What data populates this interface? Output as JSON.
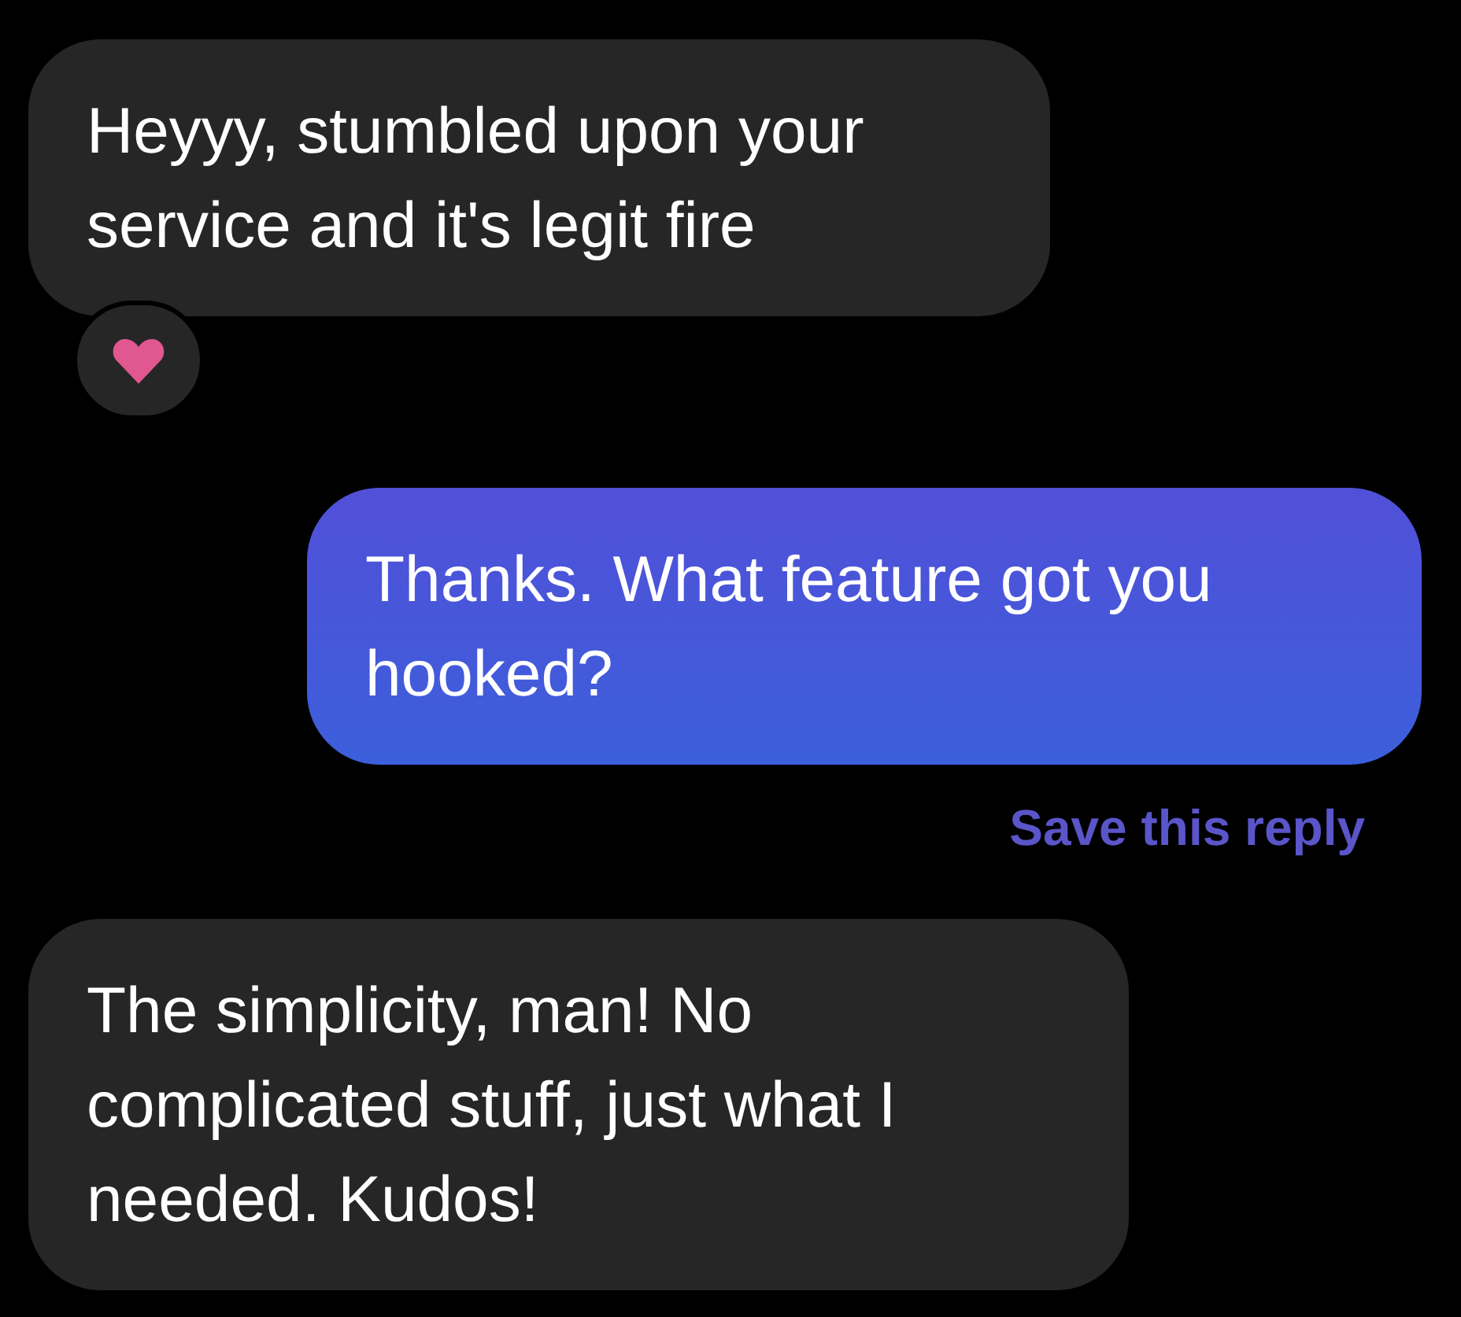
{
  "messages": [
    {
      "kind": "received",
      "text": "Heyyy, stumbled upon your service and it's legit fire",
      "hearted": true
    },
    {
      "kind": "sent",
      "text": "Thanks. What feature got you hooked?",
      "action": "Save this reply"
    },
    {
      "kind": "received",
      "text": "The simplicity, man! No complicated stuff, just what I needed. Kudos!"
    }
  ]
}
